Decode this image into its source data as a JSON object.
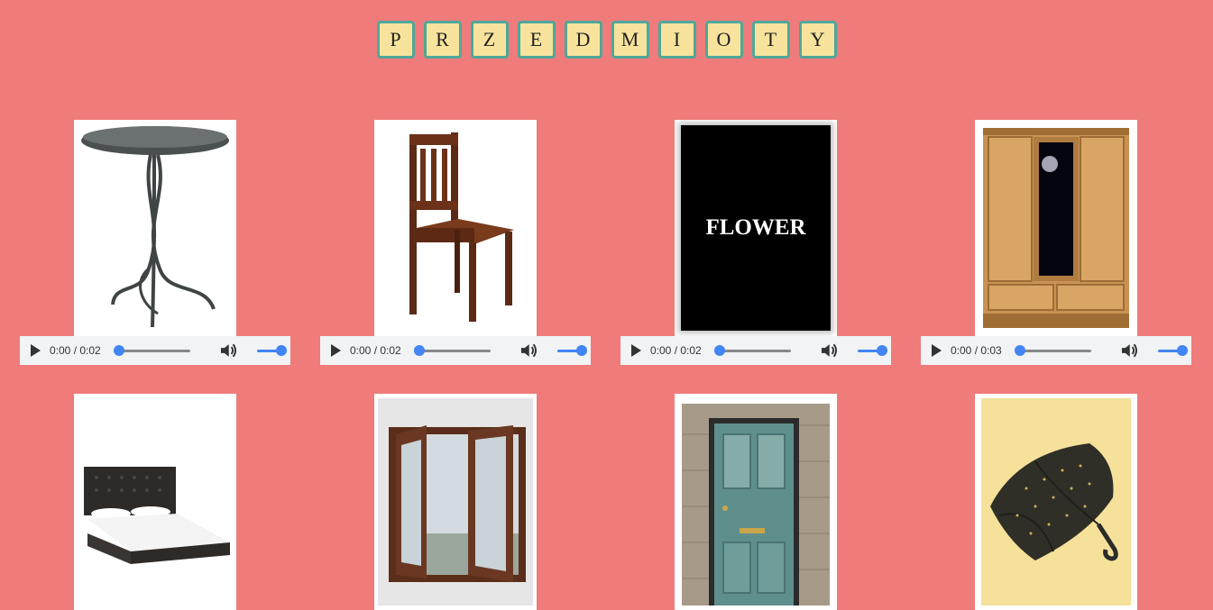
{
  "title": {
    "letters": [
      "P",
      "R",
      "Z",
      "E",
      "D",
      "M",
      "I",
      "O",
      "T",
      "Y"
    ]
  },
  "colors": {
    "background": "#f07b7b",
    "tile_fill": "#f7e39c",
    "tile_border": "#4fa79a",
    "accent": "#4285f4"
  },
  "items": [
    {
      "name": "table",
      "image_text": "",
      "audio": {
        "time": "0:00 / 0:02",
        "progress": 0,
        "volume": 1
      }
    },
    {
      "name": "chair",
      "image_text": "",
      "audio": {
        "time": "0:00 / 0:02",
        "progress": 0,
        "volume": 1
      }
    },
    {
      "name": "flower",
      "image_text": "FLOWER",
      "audio": {
        "time": "0:00 / 0:02",
        "progress": 0,
        "volume": 1
      }
    },
    {
      "name": "wardrobe",
      "image_text": "",
      "audio": {
        "time": "0:00 / 0:03",
        "progress": 0,
        "volume": 1
      }
    },
    {
      "name": "bed",
      "image_text": ""
    },
    {
      "name": "window",
      "image_text": ""
    },
    {
      "name": "door",
      "image_text": ""
    },
    {
      "name": "umbrella",
      "image_text": ""
    }
  ]
}
